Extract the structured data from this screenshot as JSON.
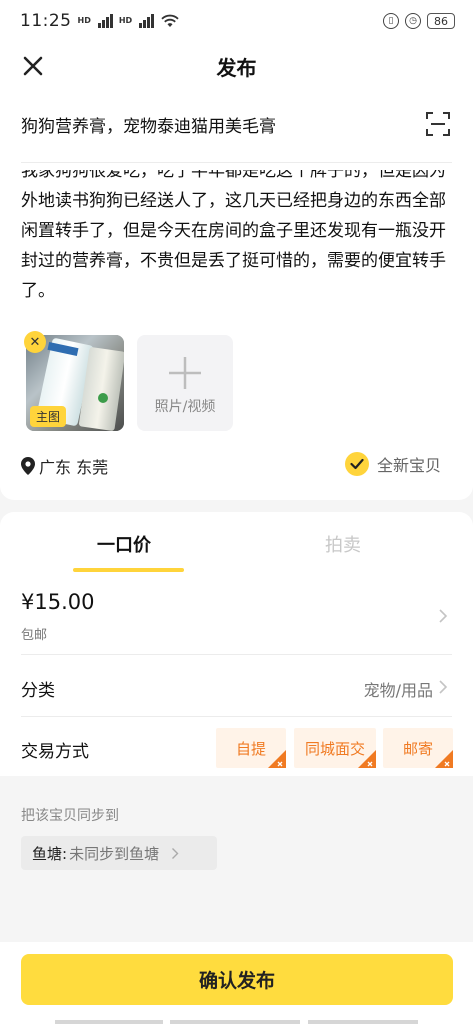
{
  "status_bar": {
    "time": "11:25",
    "battery": "86"
  },
  "header": {
    "title": "发布"
  },
  "form": {
    "title_text": "狗狗营养膏，宠物泰迪猫用美毛膏",
    "description": "我家狗狗很爱吃，吃了半年都是吃这个牌子的，但是因为外地读书狗狗已经送人了，这几天已经把身边的东西全部闲置转手了，但是今天在房间的盒子里还发现有一瓶没开封过的营养膏，不贵但是丢了挺可惜的，需要的便宜转手了。",
    "photo_badge": "主图",
    "add_media_label": "照片/视频",
    "location": "广东 东莞",
    "condition": "全新宝贝"
  },
  "pricing": {
    "tabs": [
      "一口价",
      "拍卖"
    ],
    "price": "¥15.00",
    "shipping": "包邮"
  },
  "category": {
    "label": "分类",
    "value": "宠物/用品"
  },
  "trade": {
    "label": "交易方式",
    "options": [
      "自提",
      "同城面交",
      "邮寄"
    ]
  },
  "sync": {
    "title": "把该宝贝同步到",
    "pond_label": "鱼塘:",
    "pond_value": "未同步到鱼塘"
  },
  "footer": {
    "confirm_label": "确认发布"
  },
  "colors": {
    "accent": "#ffdc3e",
    "chip_text": "#f07a22",
    "chip_bg": "#fff3e8"
  }
}
